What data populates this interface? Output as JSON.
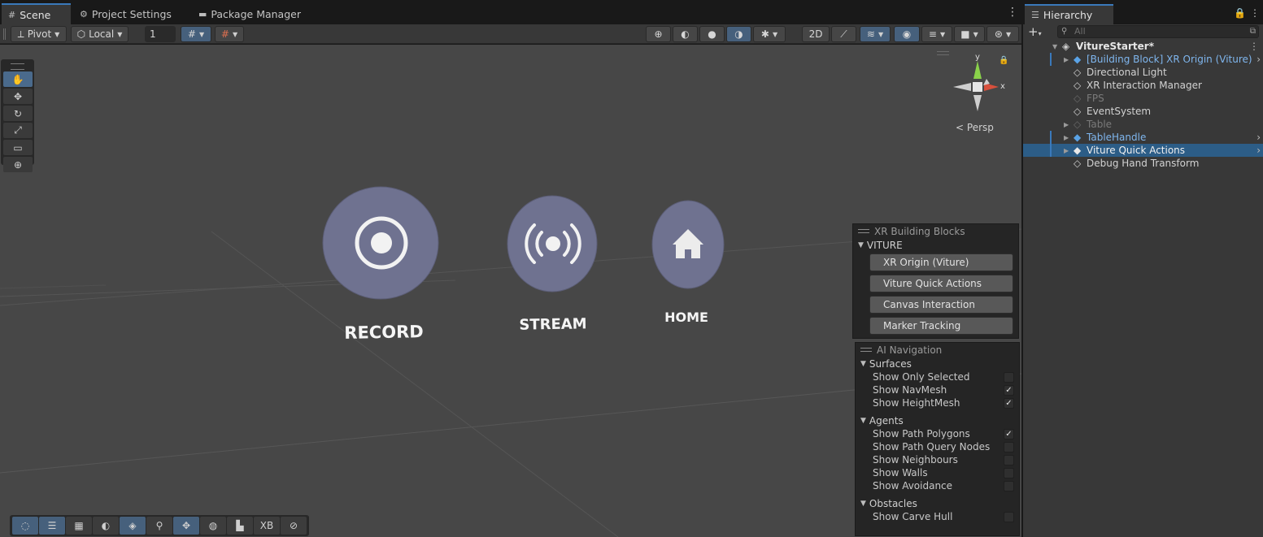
{
  "scene_tabs": [
    {
      "label": "Scene",
      "icon": "hash-icon"
    },
    {
      "label": "Project Settings",
      "icon": "gear-icon"
    },
    {
      "label": "Package Manager",
      "icon": "package-icon"
    }
  ],
  "toolbar": {
    "pivot_label": "Pivot",
    "local_label": "Local",
    "grid_size_value": "1"
  },
  "viewport": {
    "persp_label": "Persp",
    "axis_y": "y",
    "axis_x": "x",
    "buttons": [
      {
        "label": "RECORD",
        "icon": "record-icon"
      },
      {
        "label": "STREAM",
        "icon": "broadcast-icon"
      },
      {
        "label": "HOME",
        "icon": "home-icon"
      }
    ]
  },
  "building_blocks": {
    "title": "XR Building Blocks",
    "group": "VITURE",
    "items": [
      "XR Origin (Viture)",
      "Viture Quick Actions",
      "Canvas Interaction",
      "Marker Tracking"
    ]
  },
  "ai_navigation": {
    "title": "AI Navigation",
    "sections": [
      {
        "name": "Surfaces",
        "items": [
          {
            "label": "Show Only Selected",
            "checked": false
          },
          {
            "label": "Show NavMesh",
            "checked": true
          },
          {
            "label": "Show HeightMesh",
            "checked": true
          }
        ]
      },
      {
        "name": "Agents",
        "items": [
          {
            "label": "Show Path Polygons",
            "checked": true
          },
          {
            "label": "Show Path Query Nodes",
            "checked": false
          },
          {
            "label": "Show Neighbours",
            "checked": false
          },
          {
            "label": "Show Walls",
            "checked": false
          },
          {
            "label": "Show Avoidance",
            "checked": false
          }
        ]
      },
      {
        "name": "Obstacles",
        "items": [
          {
            "label": "Show Carve Hull",
            "checked": false
          }
        ]
      }
    ]
  },
  "bottom_toolbar": {
    "xb_label": "XB"
  },
  "hierarchy": {
    "tab_label": "Hierarchy",
    "search_placeholder": "All",
    "scene_name": "VitureStarter*",
    "items": [
      {
        "label": "[Building Block] XR Origin (Viture)",
        "style": "blue",
        "expandable": true,
        "chevron": true,
        "marked": true
      },
      {
        "label": "Directional Light",
        "style": "normal",
        "expandable": false,
        "chevron": false
      },
      {
        "label": "XR Interaction Manager",
        "style": "normal",
        "expandable": false,
        "chevron": false
      },
      {
        "label": "FPS",
        "style": "dim",
        "expandable": false,
        "chevron": false
      },
      {
        "label": "EventSystem",
        "style": "normal",
        "expandable": false,
        "chevron": false
      },
      {
        "label": "Table",
        "style": "dim",
        "expandable": true,
        "chevron": false
      },
      {
        "label": "TableHandle",
        "style": "blue",
        "expandable": true,
        "chevron": true,
        "marked": true
      },
      {
        "label": "Viture Quick Actions",
        "style": "selected",
        "expandable": true,
        "chevron": true,
        "marked": true
      },
      {
        "label": "Debug Hand Transform",
        "style": "normal",
        "expandable": false,
        "chevron": false
      }
    ]
  },
  "colors": {
    "accent": "#3a79bb",
    "selection": "#2c5d87",
    "viewport_bg": "#474747",
    "disc": "#6f7290"
  }
}
